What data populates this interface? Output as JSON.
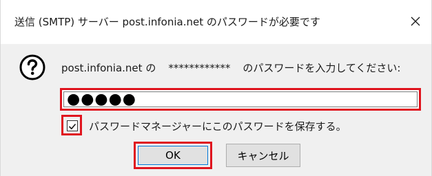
{
  "window": {
    "title": "送信 (SMTP) サーバー post.infonia.net のパスワードが必要です",
    "close_icon": "close-icon"
  },
  "prompt": {
    "icon": "question-icon",
    "server": "post.infonia.net の",
    "masked_user": "************",
    "text": "のパスワードを入力してください:"
  },
  "password_field": {
    "value": "●●●●●"
  },
  "remember_checkbox": {
    "checked": true,
    "label": "パスワードマネージャーにこのパスワードを保存する。"
  },
  "buttons": {
    "ok_label": "OK",
    "cancel_label": "キャンセル"
  },
  "colors": {
    "highlight": "#e0141e",
    "focus": "#0078d7"
  }
}
